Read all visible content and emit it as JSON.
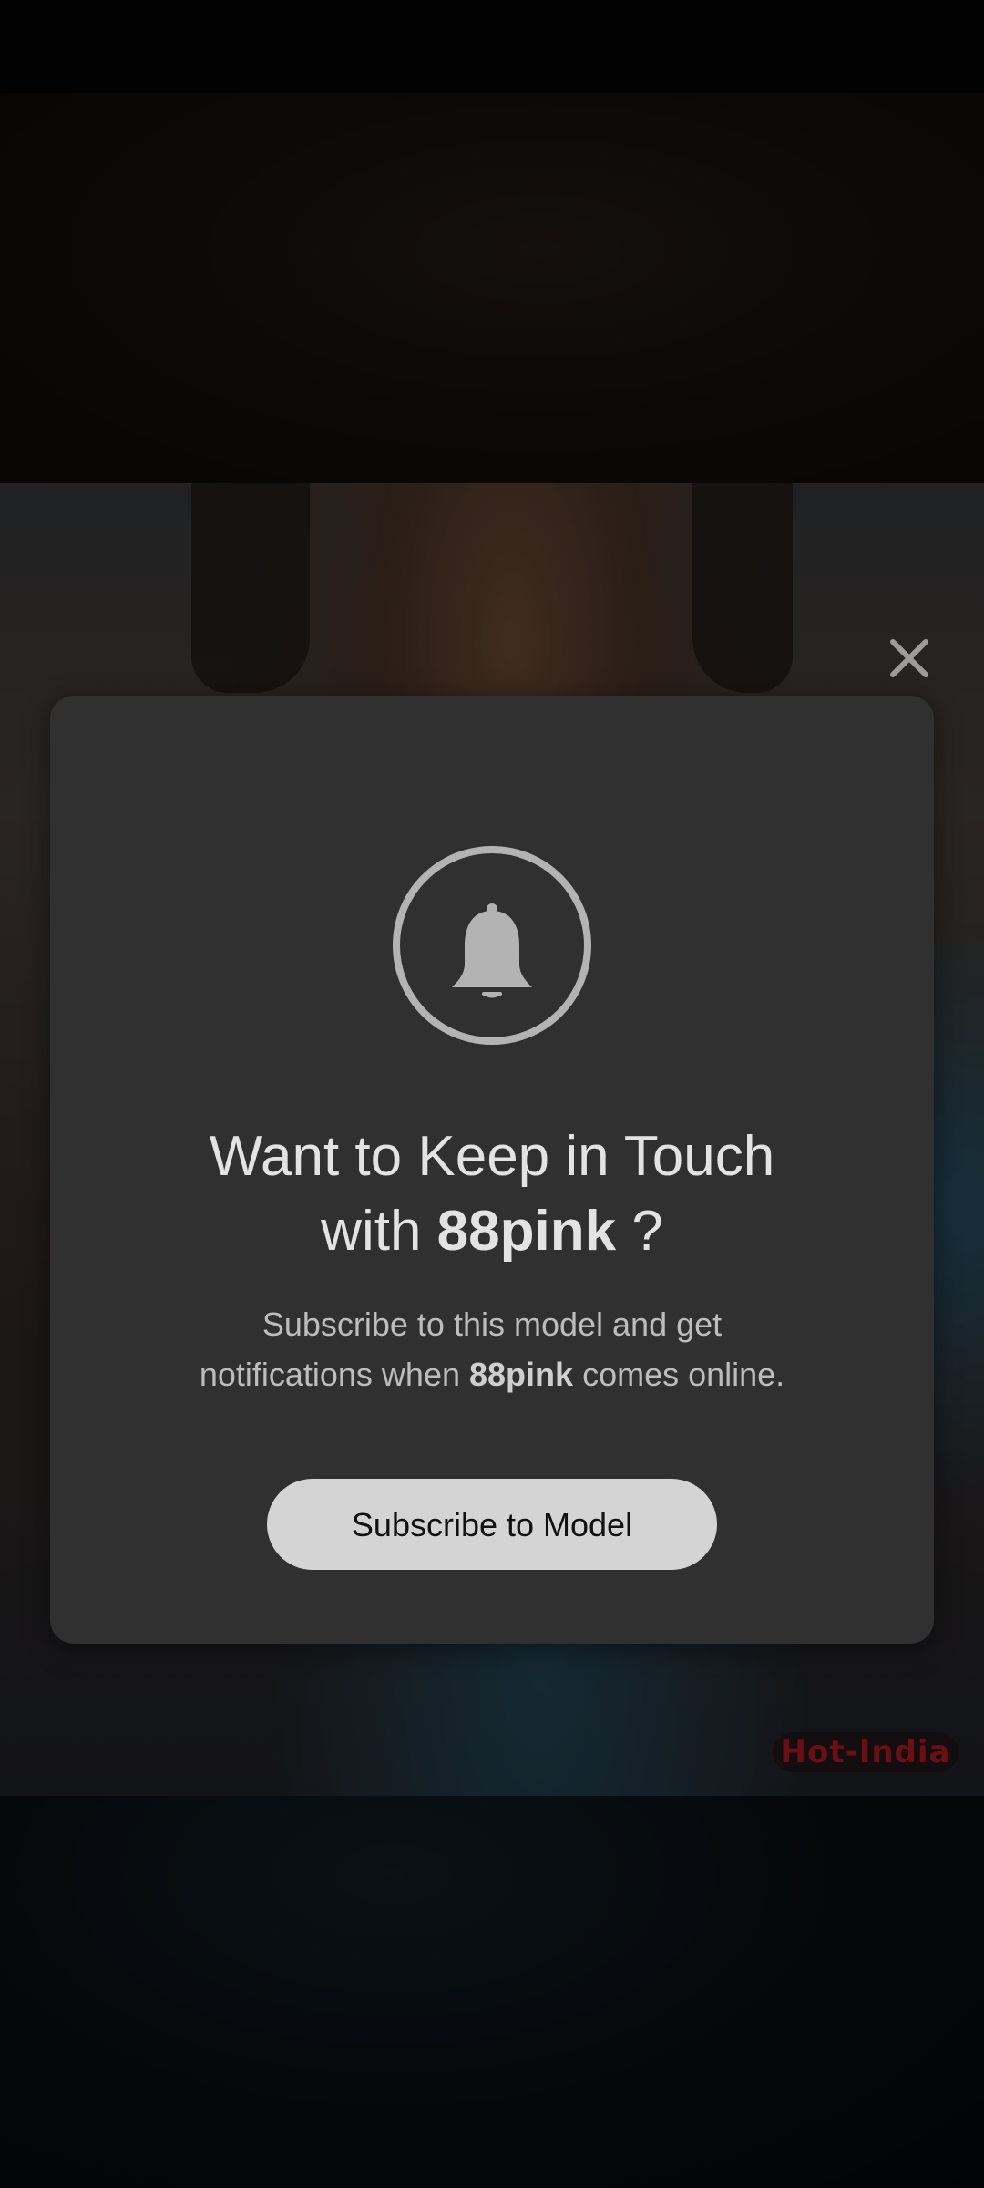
{
  "stream": {
    "watermark_text": "Hot-India"
  },
  "modal": {
    "close_icon": "close-icon",
    "bell_icon": "bell-icon",
    "title_prefix": "Want to Keep in Touch",
    "title_with": "with",
    "model_name": "88pink",
    "title_suffix": "?",
    "description_prefix": "Subscribe to this model and get notifications when",
    "description_suffix": "comes online.",
    "subscribe_button_label": "Subscribe to Model"
  },
  "colors": {
    "modal_background": "#303030",
    "button_background": "#d4d4d4",
    "icon_color": "#b3b3b3",
    "watermark_color": "#6a0f14"
  }
}
